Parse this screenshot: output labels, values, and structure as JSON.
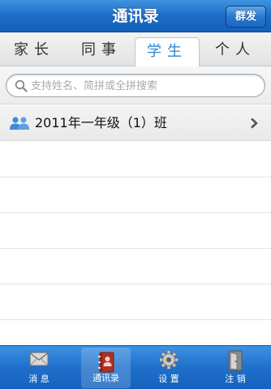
{
  "navbar": {
    "title": "通讯录",
    "broadcast_label": "群发"
  },
  "tabs": [
    {
      "label": "家长",
      "active": false
    },
    {
      "label": "同事",
      "active": false
    },
    {
      "label": "学生",
      "active": true
    },
    {
      "label": "个人",
      "active": false
    }
  ],
  "search": {
    "placeholder": "支持姓名、简拼或全拼搜索",
    "value": ""
  },
  "list": {
    "items": [
      {
        "label": "2011年一年级（1）班",
        "icon": "group-icon"
      }
    ]
  },
  "tabbar": {
    "items": [
      {
        "label": "消 息",
        "icon": "mail-icon",
        "selected": false
      },
      {
        "label": "通讯录",
        "icon": "contacts-book-icon",
        "selected": true
      },
      {
        "label": "设 置",
        "icon": "gear-icon",
        "selected": false
      },
      {
        "label": "注 销",
        "icon": "logout-door-icon",
        "selected": false
      }
    ]
  },
  "colors": {
    "brand_blue": "#1c6cc6",
    "active_tab_text": "#2a84d0"
  }
}
